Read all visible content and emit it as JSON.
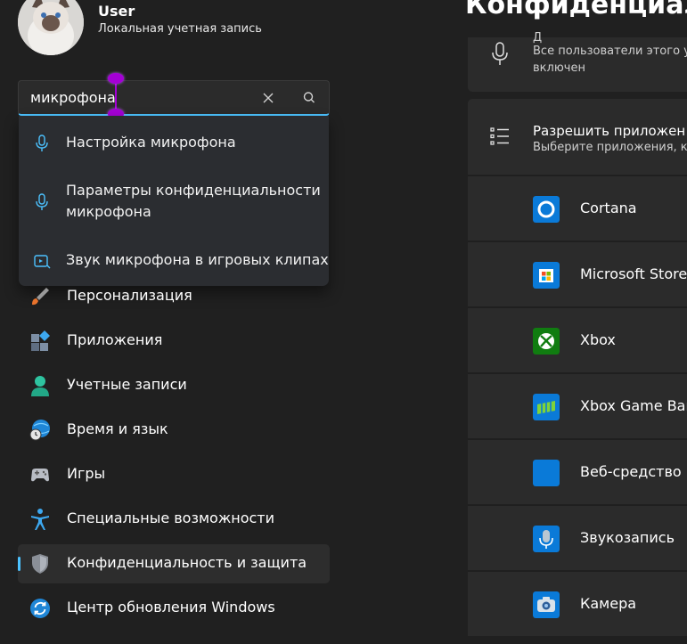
{
  "user": {
    "name": "User",
    "account_type": "Локальная учетная запись"
  },
  "search": {
    "value": "микрофона"
  },
  "suggestions": [
    {
      "icon": "microphone-icon",
      "lines": [
        "Настройка микрофона"
      ]
    },
    {
      "icon": "microphone-icon",
      "lines": [
        "Параметры конфиденциальности",
        "микрофона"
      ]
    },
    {
      "icon": "game-clip-icon",
      "lines": [
        "Звук микрофона в игровых клипах"
      ]
    }
  ],
  "nav": [
    {
      "icon": "brush-icon",
      "label": "Персонализация"
    },
    {
      "icon": "apps-icon",
      "label": "Приложения"
    },
    {
      "icon": "accounts-icon",
      "label": "Учетные записи"
    },
    {
      "icon": "globe-clock-icon",
      "label": "Время и язык"
    },
    {
      "icon": "gamepad-icon",
      "label": "Игры"
    },
    {
      "icon": "accessibility-icon",
      "label": "Специальные возможности"
    },
    {
      "icon": "shield-icon",
      "label": "Конфиденциальность и защита",
      "selected": true
    },
    {
      "icon": "refresh-icon",
      "label": "Центр обновления Windows"
    }
  ],
  "main": {
    "title": "Конфиденциал",
    "top_card": {
      "line1": "Д",
      "line2": "Все пользователи этого у",
      "line3": "включен"
    },
    "apps_header": {
      "title": "Разрешить приложен",
      "subtitle": "Выберите приложения, к"
    },
    "apps": [
      {
        "name": "Cortana",
        "icon": "cortana-icon",
        "color": "#0a7ad8"
      },
      {
        "name": "Microsoft Store",
        "icon": "store-icon",
        "color": "#0a7ad8"
      },
      {
        "name": "Xbox",
        "icon": "xbox-icon",
        "color": "#107c10"
      },
      {
        "name": "Xbox Game Bar",
        "icon": "game-bar-icon",
        "color": "#0a7ad8"
      },
      {
        "name": "Веб-средство п",
        "icon": "web-tool-icon",
        "color": "#0a7ad8"
      },
      {
        "name": "Звукозапись",
        "icon": "voice-recorder-icon",
        "color": "#0a7ad8"
      },
      {
        "name": "Камера",
        "icon": "camera-icon",
        "color": "#0a7ad8"
      }
    ]
  },
  "colors": {
    "accent": "#4cc2ff",
    "background": "#202020",
    "card": "#2b2b2b",
    "caret": "#a400d6"
  }
}
